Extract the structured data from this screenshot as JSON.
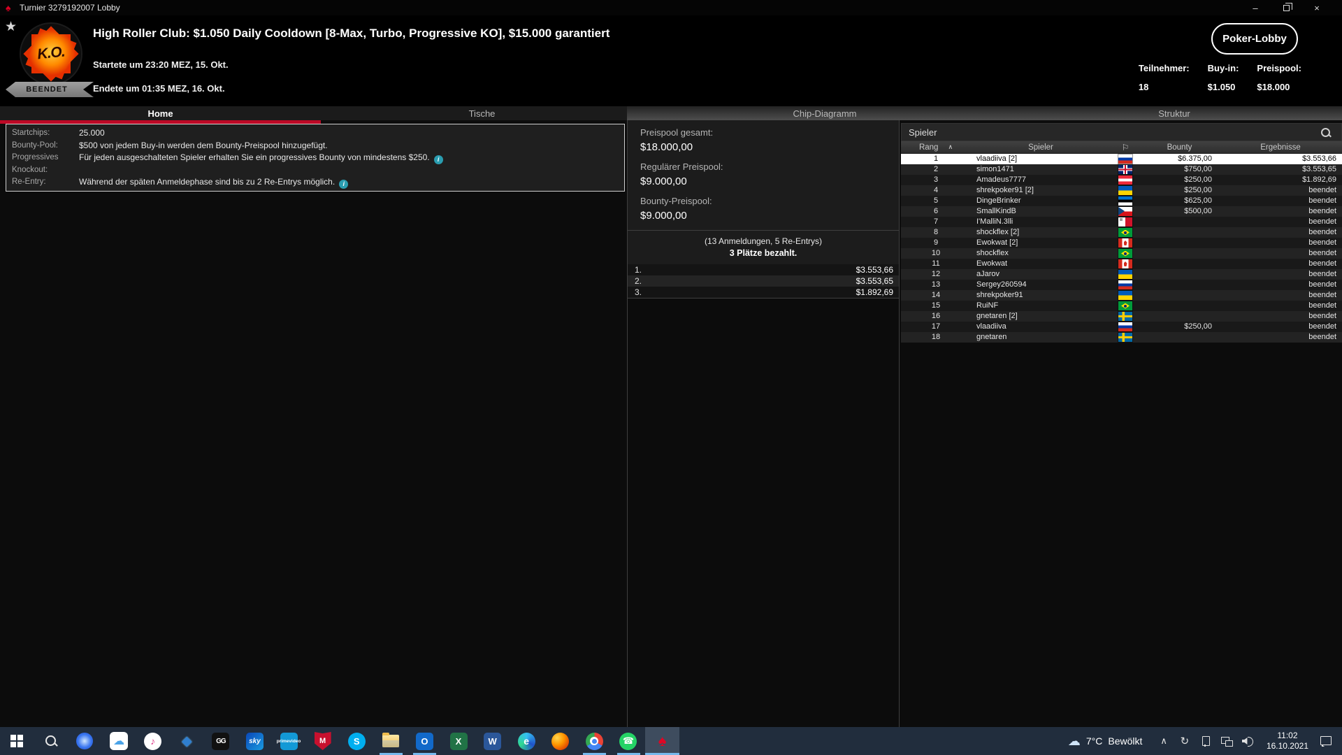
{
  "window": {
    "title": "Turnier 3279192007 Lobby",
    "minimize": "–",
    "close": "×"
  },
  "header": {
    "logo_text": "K.O.",
    "status_badge": "BEENDET",
    "title": "High Roller Club: $1.050 Daily Cooldown [8-Max, Turbo, Progressive KO], $15.000 garantiert",
    "started": "Startete um 23:20 MEZ, 15. Okt.",
    "ended": "Endete um 01:35 MEZ, 16. Okt.",
    "lobby_button": "Poker-Lobby",
    "stats": [
      {
        "label": "Teilnehmer:",
        "value": "18"
      },
      {
        "label": "Buy-in:",
        "value": "$1.050"
      },
      {
        "label": "Preispool:",
        "value": "$18.000"
      }
    ]
  },
  "tabs": [
    {
      "label": "Home",
      "active": true
    },
    {
      "label": "Tische",
      "active": false
    },
    {
      "label": "Chip-Diagramm",
      "active": false
    },
    {
      "label": "Struktur",
      "active": false
    }
  ],
  "info_panel": {
    "rows": [
      {
        "label": "Startchips:",
        "value": "25.000",
        "info": false
      },
      {
        "label": "Bounty-Pool:",
        "value": "$500 von jedem Buy-in werden dem Bounty-Preispool hinzugefügt.",
        "info": false
      },
      {
        "label": "Progressives Knockout:",
        "value": "Für jeden ausgeschalteten Spieler erhalten Sie ein progressives Bounty von mindestens $250.",
        "info": true
      },
      {
        "label": "Re-Entry:",
        "value": "Während der späten Anmeldephase sind bis zu 2 Re-Entrys möglich.",
        "info": true
      }
    ]
  },
  "prize_panel": {
    "pools": [
      {
        "label": "Preispool gesamt:",
        "value": "$18.000,00"
      },
      {
        "label": "Regulärer Preispool:",
        "value": "$9.000,00"
      },
      {
        "label": "Bounty-Preispool:",
        "value": "$9.000,00"
      }
    ],
    "registrations": "(13 Anmeldungen, 5 Re-Entrys)",
    "places_paid": "3 Plätze bezahlt.",
    "payouts": [
      {
        "place": "1.",
        "amount": "$3.553,66"
      },
      {
        "place": "2.",
        "amount": "$3.553,65"
      },
      {
        "place": "3.",
        "amount": "$1.892,69"
      }
    ]
  },
  "players_panel": {
    "search_placeholder": "Spieler",
    "columns": {
      "rank": "Rang",
      "player": "Spieler",
      "bounty": "Bounty",
      "results": "Ergebnisse"
    },
    "rows": [
      {
        "rank": "1",
        "player": "vlaadiiva [2]",
        "country": "ru",
        "bounty": "$6.375,00",
        "result": "$3.553,66",
        "selected": true
      },
      {
        "rank": "2",
        "player": "simon1471",
        "country": "gb",
        "bounty": "$750,00",
        "result": "$3.553,65",
        "selected": false
      },
      {
        "rank": "3",
        "player": "Amadeus7777",
        "country": "at",
        "bounty": "$250,00",
        "result": "$1.892,69",
        "selected": false
      },
      {
        "rank": "4",
        "player": "shrekpoker91 [2]",
        "country": "ua",
        "bounty": "$250,00",
        "result": "beendet",
        "selected": false
      },
      {
        "rank": "5",
        "player": "DingeBrinker",
        "country": "ee",
        "bounty": "$625,00",
        "result": "beendet",
        "selected": false
      },
      {
        "rank": "6",
        "player": "SmallKindB",
        "country": "cz",
        "bounty": "$500,00",
        "result": "beendet",
        "selected": false
      },
      {
        "rank": "7",
        "player": "I'MalliN.3lli",
        "country": "mt",
        "bounty": "",
        "result": "beendet",
        "selected": false
      },
      {
        "rank": "8",
        "player": "shockflex [2]",
        "country": "br",
        "bounty": "",
        "result": "beendet",
        "selected": false
      },
      {
        "rank": "9",
        "player": "Ewokwat [2]",
        "country": "ca",
        "bounty": "",
        "result": "beendet",
        "selected": false
      },
      {
        "rank": "10",
        "player": "shockflex",
        "country": "br",
        "bounty": "",
        "result": "beendet",
        "selected": false
      },
      {
        "rank": "11",
        "player": "Ewokwat",
        "country": "ca",
        "bounty": "",
        "result": "beendet",
        "selected": false
      },
      {
        "rank": "12",
        "player": "aJarov",
        "country": "ua",
        "bounty": "",
        "result": "beendet",
        "selected": false
      },
      {
        "rank": "13",
        "player": "Sergey260594",
        "country": "ru",
        "bounty": "",
        "result": "beendet",
        "selected": false
      },
      {
        "rank": "14",
        "player": "shrekpoker91",
        "country": "ua",
        "bounty": "",
        "result": "beendet",
        "selected": false
      },
      {
        "rank": "15",
        "player": "RuiNF",
        "country": "br",
        "bounty": "",
        "result": "beendet",
        "selected": false
      },
      {
        "rank": "16",
        "player": "gnetaren [2]",
        "country": "se",
        "bounty": "",
        "result": "beendet",
        "selected": false
      },
      {
        "rank": "17",
        "player": "vlaadiiva",
        "country": "ru",
        "bounty": "$250,00",
        "result": "beendet",
        "selected": false
      },
      {
        "rank": "18",
        "player": "gnetaren",
        "country": "se",
        "bounty": "",
        "result": "beendet",
        "selected": false
      }
    ]
  },
  "taskbar": {
    "apps": [
      {
        "id": "start",
        "glyph": "",
        "running": false,
        "active": false
      },
      {
        "id": "search",
        "glyph": "",
        "running": false,
        "active": false
      },
      {
        "id": "signal",
        "glyph": "",
        "running": false,
        "active": false
      },
      {
        "id": "icloud",
        "glyph": "☁",
        "running": false,
        "active": false
      },
      {
        "id": "itunes",
        "glyph": "♪",
        "running": false,
        "active": false
      },
      {
        "id": "videoapp",
        "glyph": "◆",
        "running": false,
        "active": false
      },
      {
        "id": "gg",
        "glyph": "GG",
        "running": false,
        "active": false
      },
      {
        "id": "sky",
        "glyph": "sky",
        "running": false,
        "active": false
      },
      {
        "id": "prime",
        "glyph": "prime video",
        "running": false,
        "active": false
      },
      {
        "id": "mcafee",
        "glyph": "M",
        "running": false,
        "active": false
      },
      {
        "id": "skype",
        "glyph": "S",
        "running": false,
        "active": false
      },
      {
        "id": "explorer",
        "glyph": "",
        "running": true,
        "active": false
      },
      {
        "id": "outlook",
        "glyph": "O",
        "running": true,
        "active": false
      },
      {
        "id": "excel",
        "glyph": "X",
        "running": false,
        "active": false
      },
      {
        "id": "word",
        "glyph": "W",
        "running": false,
        "active": false
      },
      {
        "id": "edge",
        "glyph": "e",
        "running": false,
        "active": false
      },
      {
        "id": "firefox",
        "glyph": "",
        "running": false,
        "active": false
      },
      {
        "id": "chrome",
        "glyph": "",
        "running": true,
        "active": false
      },
      {
        "id": "whatsapp",
        "glyph": "☎",
        "running": true,
        "active": false
      },
      {
        "id": "pokerstars",
        "glyph": "♠",
        "running": true,
        "active": true
      }
    ],
    "tray": {
      "weather_temp": "7°C",
      "weather_desc": "Bewölkt",
      "time": "11:02",
      "date": "16.10.2021"
    }
  }
}
